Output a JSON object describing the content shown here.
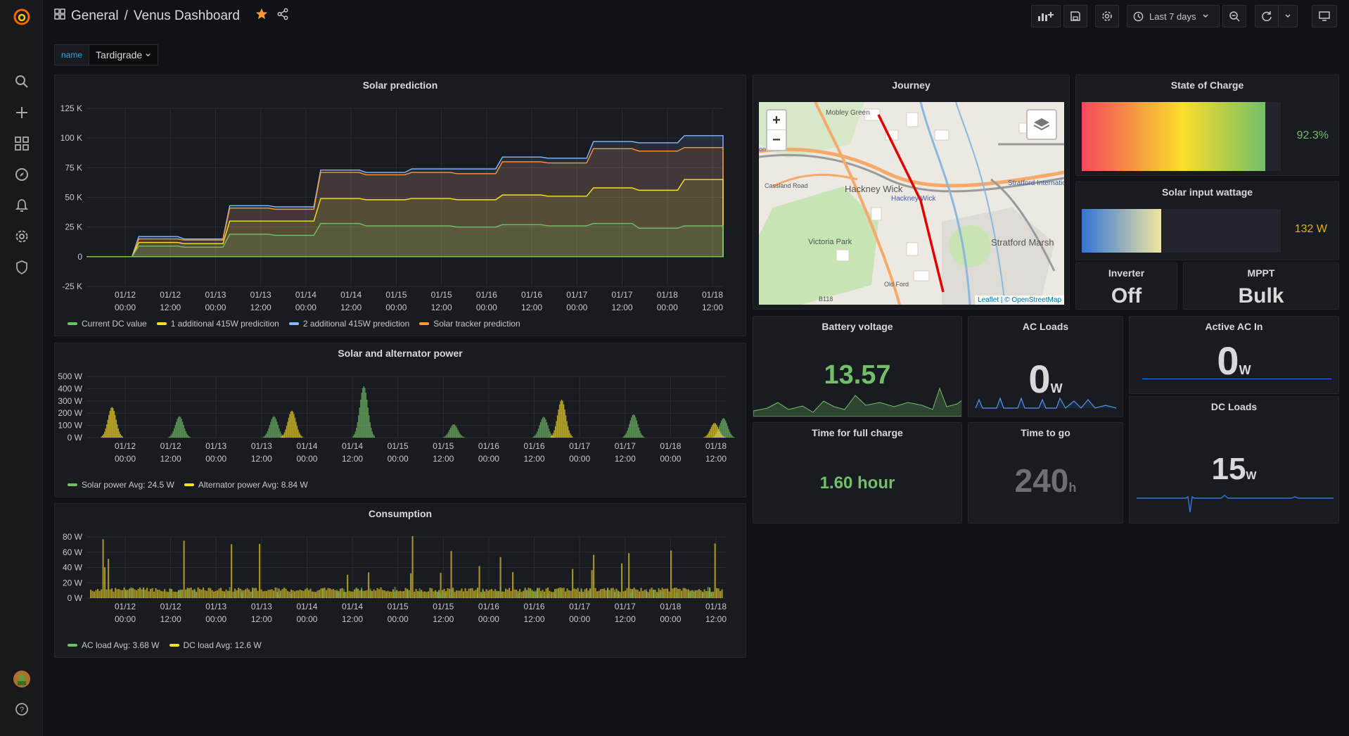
{
  "breadcrumb": {
    "folder": "General",
    "separator": "/",
    "dashboard": "Venus Dashboard"
  },
  "toolbar": {
    "time_range": "Last 7 days"
  },
  "variable": {
    "label": "name",
    "value": "Tardigrade"
  },
  "colors": {
    "green": "#73bf69",
    "yellow": "#fade2a",
    "blue": "#5794f2",
    "orange": "#ff9830",
    "cyan": "#8ab8ff",
    "accent": "#33a2e5"
  },
  "x_ticks": [
    [
      "01/12",
      "00:00"
    ],
    [
      "01/12",
      "12:00"
    ],
    [
      "01/13",
      "00:00"
    ],
    [
      "01/13",
      "12:00"
    ],
    [
      "01/14",
      "00:00"
    ],
    [
      "01/14",
      "12:00"
    ],
    [
      "01/15",
      "00:00"
    ],
    [
      "01/15",
      "12:00"
    ],
    [
      "01/16",
      "00:00"
    ],
    [
      "01/16",
      "12:00"
    ],
    [
      "01/17",
      "00:00"
    ],
    [
      "01/17",
      "12:00"
    ],
    [
      "01/18",
      "00:00"
    ],
    [
      "01/18",
      "12:00"
    ]
  ],
  "panels": {
    "solar_prediction": {
      "title": "Solar prediction",
      "legend": [
        "Current DC value",
        "1 additional 415W predicition",
        "2 additional 415W prediction",
        "Solar tracker prediction"
      ]
    },
    "solar_alternator": {
      "title": "Solar and alternator power",
      "legend": [
        "Solar power  Avg: 24.5 W",
        "Alternator power  Avg: 8.84 W"
      ]
    },
    "consumption": {
      "title": "Consumption",
      "legend": [
        "AC load  Avg: 3.68 W",
        "DC load  Avg: 12.6 W"
      ]
    },
    "journey": {
      "title": "Journey",
      "zoom_in": "+",
      "zoom_out": "−",
      "attribution": "Leaflet | © OpenStreetMap",
      "labels": [
        "Mobley Green",
        "Hackney Wick",
        "Hackney Wick",
        "Stratford International",
        "Cassland Road",
        "Victoria Park",
        "Stratford Marsh",
        "Old Ford",
        "B118",
        "on"
      ]
    },
    "state_of_charge": {
      "title": "State of Charge",
      "value": "92.3%",
      "fraction": 0.923
    },
    "solar_input": {
      "title": "Solar input wattage",
      "value": "132 W",
      "fraction": 0.4
    },
    "inverter": {
      "title": "Inverter",
      "value": "Off"
    },
    "mppt": {
      "title": "MPPT",
      "value": "Bulk"
    },
    "battery_voltage": {
      "title": "Battery voltage",
      "value": "13.57"
    },
    "ac_loads": {
      "title": "AC Loads",
      "value": "0",
      "unit": "W"
    },
    "active_ac_in": {
      "title": "Active AC In",
      "value": "0",
      "unit": "W"
    },
    "time_full_charge": {
      "title": "Time for full charge",
      "value": "1.60 hour"
    },
    "time_to_go": {
      "title": "Time to go",
      "value": "240",
      "unit": "h"
    },
    "dc_loads": {
      "title": "DC Loads",
      "value": "15",
      "unit": "W"
    }
  },
  "chart_data": [
    {
      "type": "area",
      "title": "Solar prediction",
      "yticks": [
        "125 K",
        "100 K",
        "75 K",
        "50 K",
        "25 K",
        "0",
        "-25 K"
      ],
      "ylim": [
        -25000,
        125000
      ],
      "x": [
        0,
        0.5,
        1,
        1.5,
        2,
        2.5,
        3,
        3.5,
        4,
        4.5,
        5,
        5.5,
        6,
        6.5,
        7
      ],
      "series": [
        {
          "name": "Current DC value",
          "color": "#73bf69",
          "values": [
            0,
            0,
            9000,
            8000,
            19000,
            18000,
            28000,
            26000,
            26000,
            25000,
            27000,
            26000,
            28000,
            24000,
            26000
          ]
        },
        {
          "name": "1 additional 415W predicition",
          "color": "#fade2a",
          "values": [
            0,
            0,
            12000,
            11000,
            30000,
            30000,
            49000,
            48000,
            49000,
            48000,
            52000,
            51000,
            58000,
            56000,
            65000
          ]
        },
        {
          "name": "2 additional 415W prediction",
          "color": "#8ab8ff",
          "values": [
            0,
            0,
            17000,
            15000,
            43000,
            42000,
            73000,
            71000,
            74000,
            74000,
            84000,
            83000,
            97000,
            96000,
            102000
          ]
        },
        {
          "name": "Solar tracker prediction",
          "color": "#ff9830",
          "values": [
            0,
            0,
            15000,
            14000,
            41000,
            40000,
            71000,
            69000,
            71000,
            70000,
            80000,
            79000,
            91000,
            89000,
            92000
          ]
        }
      ]
    },
    {
      "type": "bar",
      "title": "Solar and alternator power",
      "yticks": [
        "500 W",
        "400 W",
        "300 W",
        "200 W",
        "100 W",
        "0 W"
      ],
      "ylim": [
        0,
        500
      ],
      "series": [
        {
          "name": "Solar power",
          "color": "#73bf69",
          "peaks": [
            [
              0.95,
              175
            ],
            [
              2.0,
              175
            ],
            [
              3.0,
              420
            ],
            [
              4.0,
              110
            ],
            [
              5.0,
              170
            ],
            [
              6.0,
              190
            ],
            [
              7.0,
              160
            ]
          ]
        },
        {
          "name": "Alternator power",
          "color": "#fade2a",
          "peaks": [
            [
              0.2,
              250
            ],
            [
              2.2,
              220
            ],
            [
              5.2,
              310
            ],
            [
              6.9,
              120
            ]
          ]
        }
      ]
    },
    {
      "type": "bar",
      "title": "Consumption",
      "yticks": [
        "80 W",
        "60 W",
        "40 W",
        "20 W",
        "0 W"
      ],
      "ylim": [
        0,
        80
      ],
      "series": [
        {
          "name": "AC load",
          "color": "#73bf69"
        },
        {
          "name": "DC load",
          "color": "#fade2a"
        }
      ]
    }
  ]
}
